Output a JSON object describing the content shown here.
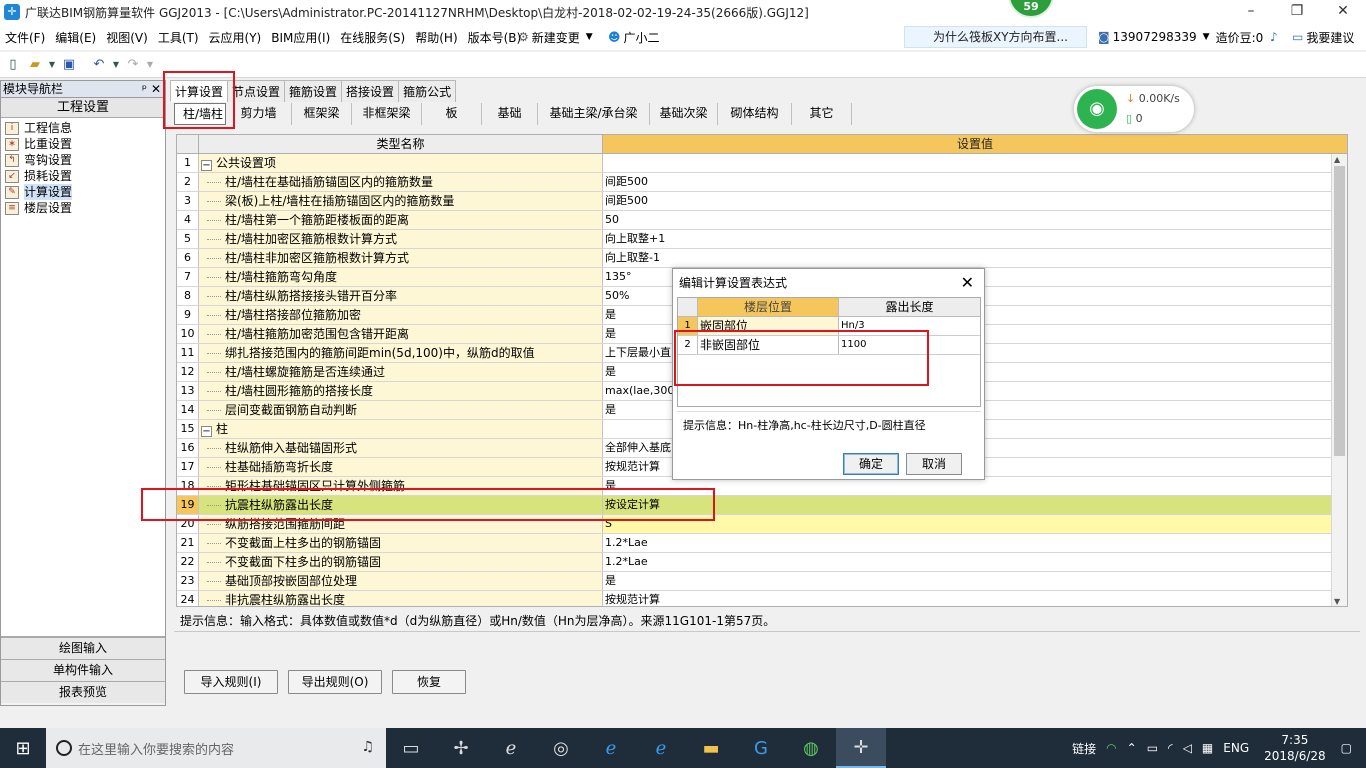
{
  "window": {
    "title": "广联达BIM钢筋算量软件 GGJ2013 - [C:\\Users\\Administrator.PC-20141127NRHM\\Desktop\\白龙村-2018-02-02-19-24-35(2666版).GGJ12]",
    "badge": "59"
  },
  "menu": {
    "items": [
      "文件(F)",
      "编辑(E)",
      "视图(V)",
      "工具(T)",
      "云应用(Y)",
      "BIM应用(I)",
      "在线服务(S)",
      "帮助(H)",
      "版本号(B)"
    ],
    "new_change": "新建变更",
    "user_guide": "广小二",
    "ad_text": "为什么筏板XY方向布置...",
    "phone": "13907298339",
    "cost_beans": "造价豆:0",
    "suggest": "我要建议"
  },
  "sidebar": {
    "header": "模块导航栏",
    "section_title": "工程设置",
    "items": [
      {
        "label": "工程信息",
        "icon": "project-info-icon"
      },
      {
        "label": "比重设置",
        "icon": "weight-ratio-icon"
      },
      {
        "label": "弯钩设置",
        "icon": "hook-icon"
      },
      {
        "label": "损耗设置",
        "icon": "loss-icon"
      },
      {
        "label": "计算设置",
        "icon": "calc-setting-icon"
      },
      {
        "label": "楼层设置",
        "icon": "floor-setting-icon"
      }
    ],
    "bottom_buttons": [
      "绘图输入",
      "单构件输入",
      "报表预览"
    ]
  },
  "tabs": {
    "top": [
      "计算设置",
      "节点设置",
      "箍筋设置",
      "搭接设置",
      "箍筋公式"
    ],
    "sub": [
      "柱/墙柱",
      "剪力墙",
      "框架梁",
      "非框架梁",
      "板",
      "基础",
      "基础主梁/承台梁",
      "基础次梁",
      "砌体结构",
      "其它"
    ]
  },
  "grid": {
    "col_name": "类型名称",
    "col_value": "设置值",
    "rows": [
      {
        "n": "1",
        "name": "公共设置项",
        "value": "",
        "group": true
      },
      {
        "n": "2",
        "name": "柱/墙柱在基础插筋锚固区内的箍筋数量",
        "value": "间距500"
      },
      {
        "n": "3",
        "name": "梁(板)上柱/墙柱在插筋锚固区内的箍筋数量",
        "value": "间距500"
      },
      {
        "n": "4",
        "name": "柱/墙柱第一个箍筋距楼板面的距离",
        "value": "50"
      },
      {
        "n": "5",
        "name": "柱/墙柱加密区箍筋根数计算方式",
        "value": "向上取整+1"
      },
      {
        "n": "6",
        "name": "柱/墙柱非加密区箍筋根数计算方式",
        "value": "向上取整-1"
      },
      {
        "n": "7",
        "name": "柱/墙柱箍筋弯勾角度",
        "value": "135°"
      },
      {
        "n": "8",
        "name": "柱/墙柱纵筋搭接接头错开百分率",
        "value": "50%"
      },
      {
        "n": "9",
        "name": "柱/墙柱搭接部位箍筋加密",
        "value": "是"
      },
      {
        "n": "10",
        "name": "柱/墙柱箍筋加密范围包含错开距离",
        "value": "是"
      },
      {
        "n": "11",
        "name": "绑扎搭接范围内的箍筋间距min(5d,100)中，纵筋d的取值",
        "value": "上下层最小直"
      },
      {
        "n": "12",
        "name": "柱/墙柱螺旋箍筋是否连续通过",
        "value": "是"
      },
      {
        "n": "13",
        "name": "柱/墙柱圆形箍筋的搭接长度",
        "value": "max(lae,300)"
      },
      {
        "n": "14",
        "name": "层间变截面钢筋自动判断",
        "value": "是"
      },
      {
        "n": "15",
        "name": "柱",
        "value": "",
        "group": true
      },
      {
        "n": "16",
        "name": "柱纵筋伸入基础锚固形式",
        "value": "全部伸入基底"
      },
      {
        "n": "17",
        "name": "柱基础插筋弯折长度",
        "value": "按规范计算"
      },
      {
        "n": "18",
        "name": "矩形柱基础锚固区只计算外侧箍筋",
        "value": "是"
      },
      {
        "n": "19",
        "name": "抗震柱纵筋露出长度",
        "value": "按设定计算",
        "selected": true
      },
      {
        "n": "20",
        "name": "纵筋搭接范围箍筋间距",
        "value": "S",
        "highlight": true
      },
      {
        "n": "21",
        "name": "不变截面上柱多出的钢筋锚固",
        "value": "1.2*Lae"
      },
      {
        "n": "22",
        "name": "不变截面下柱多出的钢筋锚固",
        "value": "1.2*Lae"
      },
      {
        "n": "23",
        "name": "基础顶部按嵌固部位处理",
        "value": "是"
      },
      {
        "n": "24",
        "name": "非抗震柱纵筋露出长度",
        "value": "按规范计算"
      }
    ]
  },
  "hint": "提示信息：输入格式：具体数值或数值*d（d为纵筋直径）或Hn/数值（Hn为层净高）。来源11G101-1第57页。",
  "buttons": {
    "import": "导入规则(I)",
    "export": "导出规则(O)",
    "restore": "恢复"
  },
  "dialog": {
    "title": "编辑计算设置表达式",
    "col1": "楼层位置",
    "col2": "露出长度",
    "rows": [
      {
        "n": "1",
        "pos": "嵌固部位",
        "len": "Hn/3"
      },
      {
        "n": "2",
        "pos": "非嵌固部位",
        "len": "1100"
      }
    ],
    "hint": "提示信息：Hn-柱净高,hc-柱长边尺寸,D-圆柱直径",
    "ok": "确定",
    "cancel": "取消"
  },
  "network": {
    "speed": "0.00K/s",
    "count": "0"
  },
  "taskbar": {
    "search_placeholder": "在这里输入你要搜索的内容",
    "link": "链接",
    "lang": "ENG",
    "time": "7:35",
    "date": "2018/6/28"
  },
  "colors": {
    "selected_row": "#d7e47e",
    "header_accent": "#f5c65c",
    "highlight_box": "#e0141d"
  }
}
